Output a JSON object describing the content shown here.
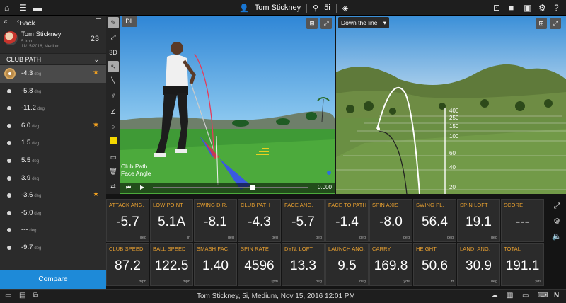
{
  "header": {
    "player_name": "Tom Stickney",
    "club": "5i"
  },
  "sidebar": {
    "back_label": "Back",
    "player_name": "Tom Stickney",
    "player_club": "5 Iron",
    "player_meta": "11/15/2016, Medium",
    "shot_count": "23",
    "section_title": "CLUB PATH",
    "shots": [
      {
        "value": "-4.3",
        "unit": "deg",
        "star": "★"
      },
      {
        "value": "-5.8",
        "unit": "deg",
        "star": ""
      },
      {
        "value": "-11.2",
        "unit": "deg",
        "star": ""
      },
      {
        "value": "6.0",
        "unit": "deg",
        "star": "★"
      },
      {
        "value": "1.5",
        "unit": "deg",
        "star": ""
      },
      {
        "value": "5.5",
        "unit": "deg",
        "star": ""
      },
      {
        "value": "3.9",
        "unit": "deg",
        "star": ""
      },
      {
        "value": "-3.6",
        "unit": "deg",
        "star": "★"
      },
      {
        "value": "-5.0",
        "unit": "deg",
        "star": ""
      },
      {
        "value": "---",
        "unit": "deg",
        "star": ""
      },
      {
        "value": "-9.7",
        "unit": "deg",
        "star": ""
      }
    ],
    "compare_label": "Compare"
  },
  "tools": {
    "mode_3d": "3D",
    "view_label": "DL"
  },
  "video": {
    "label_club_path": "Club Path",
    "label_face_angle": "Face Angle",
    "time": "0.000"
  },
  "sim": {
    "view_select": "Down the line",
    "distance_markers": [
      "400",
      "250",
      "150",
      "100",
      "60",
      "40",
      "20"
    ]
  },
  "tiles_row1": [
    {
      "label": "ATTACK ANG.",
      "value": "-5.7",
      "unit": "deg"
    },
    {
      "label": "LOW POINT",
      "value": "5.1A",
      "unit": "in"
    },
    {
      "label": "SWING DIR.",
      "value": "-8.1",
      "unit": "deg"
    },
    {
      "label": "CLUB PATH",
      "value": "-4.3",
      "unit": "deg"
    },
    {
      "label": "FACE ANG.",
      "value": "-5.7",
      "unit": "deg"
    },
    {
      "label": "FACE TO PATH",
      "value": "-1.4",
      "unit": "deg"
    },
    {
      "label": "SPIN AXIS",
      "value": "-8.0",
      "unit": "deg"
    },
    {
      "label": "SWING PL.",
      "value": "56.4",
      "unit": "deg"
    },
    {
      "label": "SPIN LOFT",
      "value": "19.1",
      "unit": "deg"
    },
    {
      "label": "SCORE",
      "value": "---",
      "unit": ""
    }
  ],
  "tiles_row2": [
    {
      "label": "CLUB SPEED",
      "value": "87.2",
      "unit": "mph"
    },
    {
      "label": "BALL SPEED",
      "value": "122.5",
      "unit": "mph"
    },
    {
      "label": "SMASH FAC.",
      "value": "1.40",
      "unit": ""
    },
    {
      "label": "SPIN RATE",
      "value": "4596",
      "unit": "rpm"
    },
    {
      "label": "DYN. LOFT",
      "value": "13.3",
      "unit": "deg"
    },
    {
      "label": "LAUNCH ANG.",
      "value": "9.5",
      "unit": "deg"
    },
    {
      "label": "CARRY",
      "value": "169.8",
      "unit": "yds"
    },
    {
      "label": "HEIGHT",
      "value": "50.6",
      "unit": "ft"
    },
    {
      "label": "LAND. ANG.",
      "value": "30.9",
      "unit": "deg"
    },
    {
      "label": "TOTAL",
      "value": "191.1",
      "unit": "yds"
    }
  ],
  "footer": {
    "status": "Tom Stickney, 5i, Medium, Nov 15, 2016 12:01 PM",
    "brand": "N"
  },
  "colors": {
    "accent": "#1e8ad8",
    "label": "#e8a030",
    "star": "#f0a020"
  }
}
